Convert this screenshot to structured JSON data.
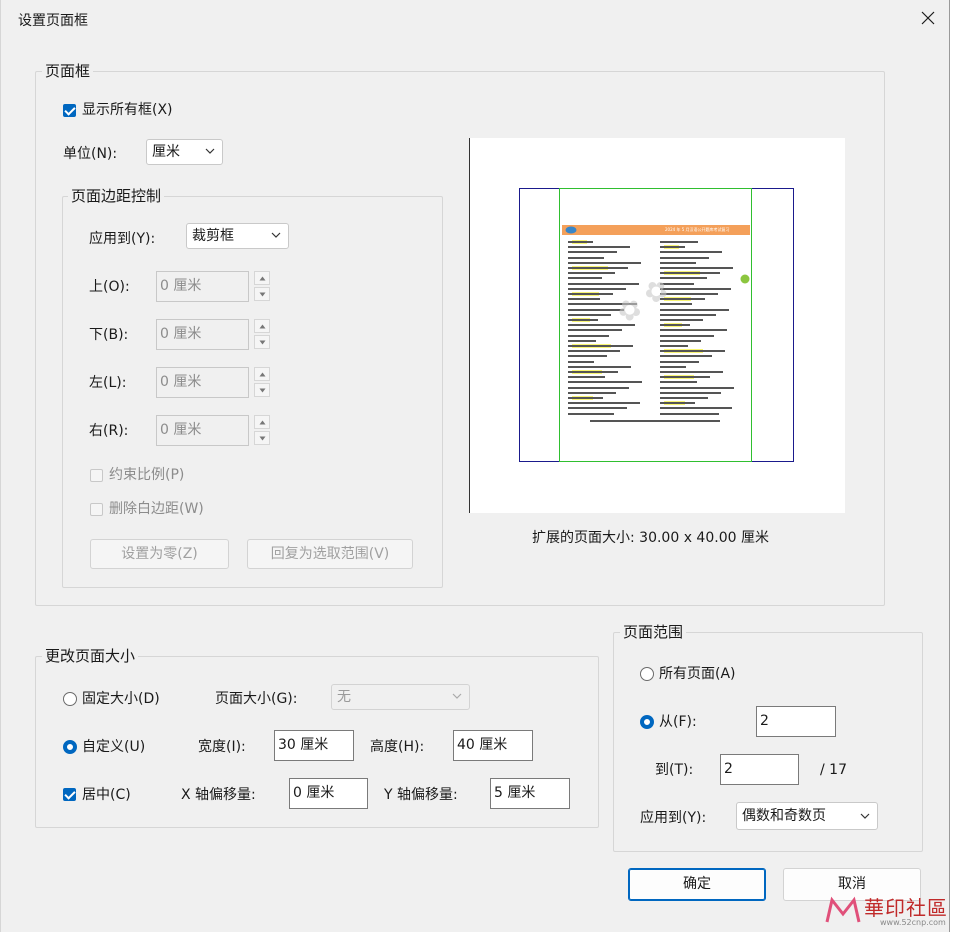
{
  "window": {
    "title": "设置页面框"
  },
  "page_box": {
    "legend": "页面框",
    "show_all_boxes": {
      "label": "显示所有框(X)",
      "checked": true
    },
    "unit": {
      "label": "单位(N):",
      "value": "厘米"
    },
    "margin_control": {
      "legend": "页面边距控制",
      "apply_to": {
        "label": "应用到(Y):",
        "value": "裁剪框"
      },
      "fields": [
        {
          "label": "上(O):",
          "value": "0 厘米"
        },
        {
          "label": "下(B):",
          "value": "0 厘米"
        },
        {
          "label": "左(L):",
          "value": "0 厘米"
        },
        {
          "label": "右(R):",
          "value": "0 厘米"
        }
      ],
      "constrain": {
        "label": "约束比例(P)",
        "checked": false
      },
      "remove_white": {
        "label": "删除白边距(W)",
        "checked": false
      },
      "set_zero_button": "设置为零(Z)",
      "revert_button": "回复为选取范围(V)"
    },
    "preview_caption": "扩展的页面大小:  30.00 x 40.00 厘米",
    "preview_doc_title": "2024 年 5 月汉语公开题库考试复习"
  },
  "change_size": {
    "legend": "更改页面大小",
    "fixed": {
      "label": "固定大小(D)",
      "selected": false
    },
    "page_size": {
      "label": "页面大小(G):",
      "value": "无"
    },
    "custom": {
      "label": "自定义(U)",
      "selected": true
    },
    "width": {
      "label": "宽度(I):",
      "value": "30 厘米"
    },
    "height": {
      "label": "高度(H):",
      "value": "40 厘米"
    },
    "center": {
      "label": "居中(C)",
      "checked": true
    },
    "x_offset": {
      "label": "X 轴偏移量:",
      "value": "0 厘米"
    },
    "y_offset": {
      "label": "Y 轴偏移量:",
      "value": "5 厘米"
    }
  },
  "page_range": {
    "legend": "页面范围",
    "all": {
      "label": "所有页面(A)",
      "selected": false
    },
    "from": {
      "label": "从(F):",
      "value": "2",
      "selected": true
    },
    "to": {
      "label": "到(T):",
      "value": "2"
    },
    "total": "/ 17",
    "apply_to": {
      "label": "应用到(Y):",
      "value": "偶数和奇数页"
    }
  },
  "buttons": {
    "ok": "确定",
    "cancel": "取消"
  },
  "watermark": {
    "text": "華印社區",
    "url": "www.52cnp.com"
  },
  "colors": {
    "accent": "#0067c0",
    "crop_box": "#2fbf2f",
    "media_box": "#1a1a8c",
    "doc_header": "#f4a05a",
    "highlight": "#f6f250"
  }
}
